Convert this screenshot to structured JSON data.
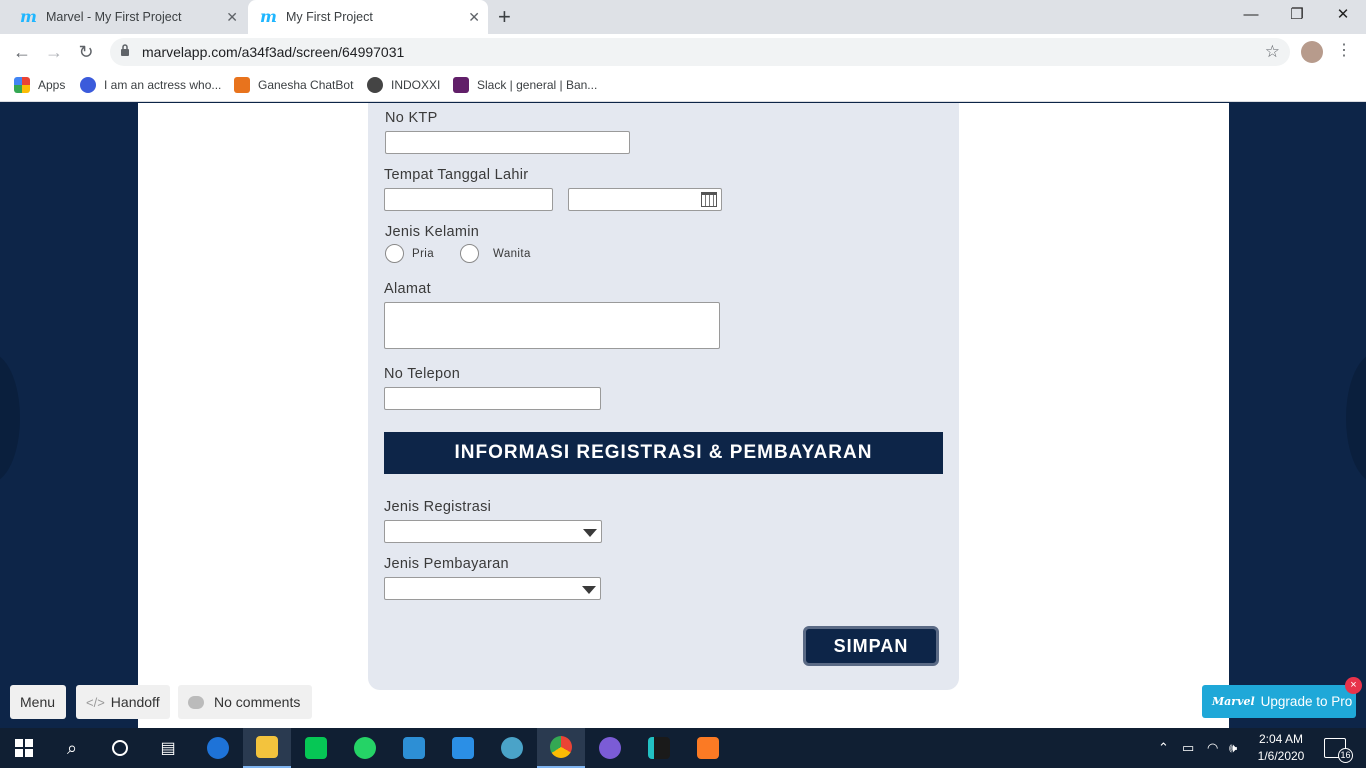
{
  "browser": {
    "tabs": [
      {
        "title": "Marvel - My First Project"
      },
      {
        "title": "My First Project"
      }
    ],
    "url": "marvelapp.com/a34f3ad/screen/64997031",
    "bookmarks": [
      {
        "label": "Apps"
      },
      {
        "label": "I am an actress who..."
      },
      {
        "label": "Ganesha ChatBot"
      },
      {
        "label": "INDOXXI"
      },
      {
        "label": "Slack | general | Ban..."
      }
    ]
  },
  "form": {
    "no_ktp_label": "No KTP",
    "ttl_label": "Tempat Tanggal Lahir",
    "gender_label": "Jenis Kelamin",
    "gender_options": [
      "Pria",
      "Wanita"
    ],
    "alamat_label": "Alamat",
    "telepon_label": "No Telepon",
    "section_title": "INFORMASI REGISTRASI & PEMBAYARAN",
    "registrasi_label": "Jenis Registrasi",
    "pembayaran_label": "Jenis Pembayaran",
    "submit_label": "SIMPAN"
  },
  "marvel_bar": {
    "menu_label": "Menu",
    "handoff_label": "Handoff",
    "comments_label": "No comments",
    "upgrade_label": "Upgrade to Pro",
    "upgrade_logo": "Marvel",
    "close_badge": "×"
  },
  "taskbar": {
    "time": "2:04 AM",
    "date": "1/6/2020",
    "notification_count": "16"
  }
}
